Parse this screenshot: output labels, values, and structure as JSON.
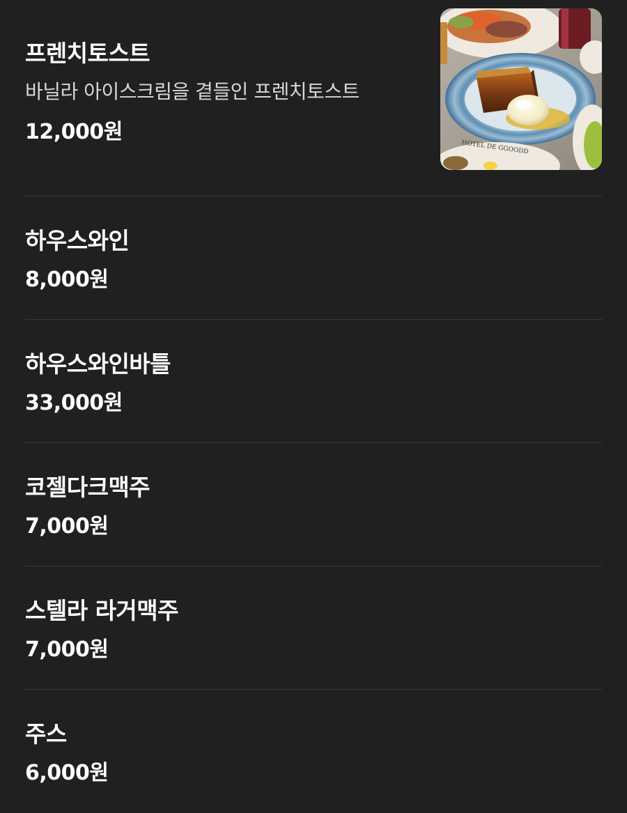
{
  "menu": {
    "items": [
      {
        "name": "프렌치토스트",
        "description": "바닐라 아이스크림을 곁들인 프렌치토스트",
        "price": "12,000원",
        "image_alt": "french-toast-with-vanilla-ice-cream",
        "plate_text": "HOTEL DE GGOODD"
      },
      {
        "name": "하우스와인",
        "price": "8,000원"
      },
      {
        "name": "하우스와인바틀",
        "price": "33,000원"
      },
      {
        "name": "코젤다크맥주",
        "price": "7,000원"
      },
      {
        "name": "스텔라 라거맥주",
        "price": "7,000원"
      },
      {
        "name": "주스",
        "price": "6,000원"
      }
    ]
  },
  "colors": {
    "background": "#202021",
    "divider": "#3a3a3c",
    "text_primary": "#ffffff",
    "text_secondary": "#d7d7d9"
  }
}
